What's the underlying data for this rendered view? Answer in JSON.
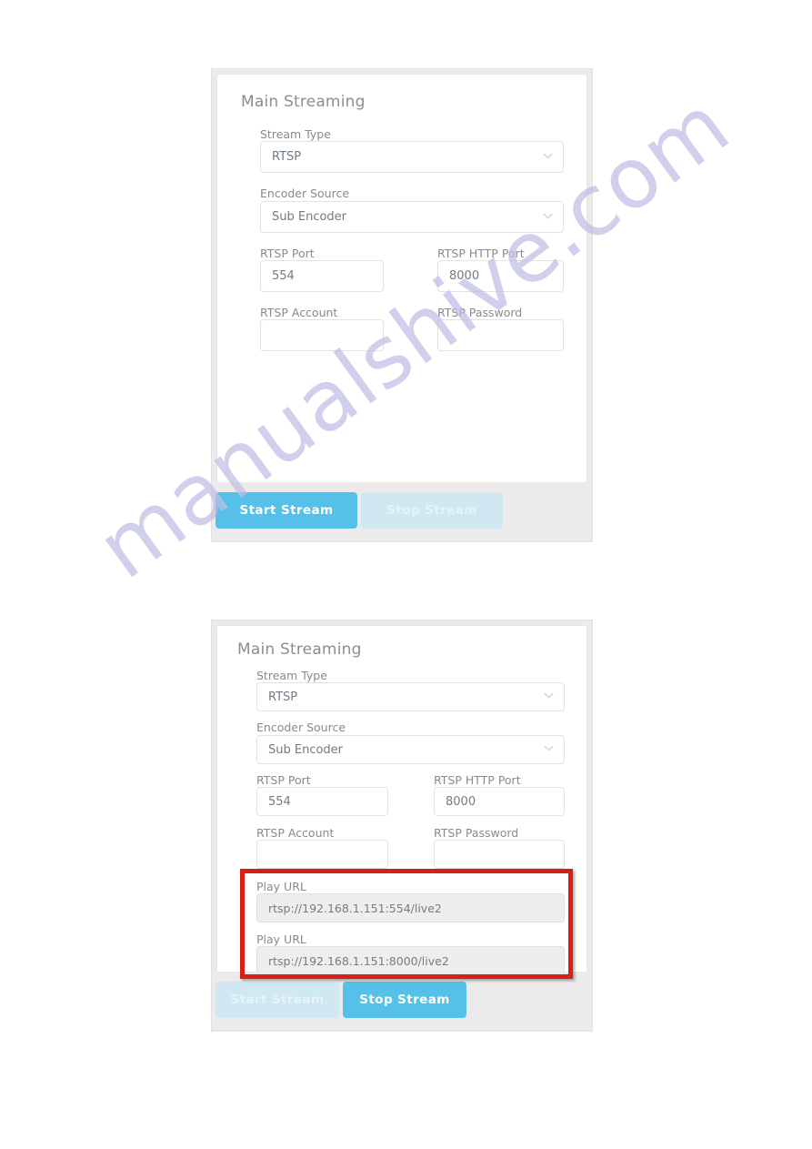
{
  "watermark": {
    "text": "manualshive.com",
    "color": "#bfbde6"
  },
  "theme": {
    "accent": "#55c1e8",
    "accent_disabled": "#cfe8f1",
    "highlight": "#d81f16",
    "panel_bg": "#eceaea",
    "card_bg": "#ffffff",
    "readonly_bg": "#eeeeee"
  },
  "panels": [
    {
      "title": "Main Streaming",
      "fields": {
        "stream_type": {
          "label": "Stream Type",
          "value": "RTSP",
          "icon": "chevron-down-icon"
        },
        "encoder_source": {
          "label": "Encoder Source",
          "value": "Sub Encoder",
          "icon": "chevron-down-icon"
        },
        "rtsp_port": {
          "label": "RTSP Port",
          "value": "554"
        },
        "rtsp_http_port": {
          "label": "RTSP HTTP Port",
          "value": "8000"
        },
        "rtsp_account": {
          "label": "RTSP Account",
          "value": ""
        },
        "rtsp_password": {
          "label": "RTSP Password",
          "value": ""
        }
      },
      "buttons": {
        "start": {
          "label": "Start Stream",
          "state": "active"
        },
        "stop": {
          "label": "Stop Stream",
          "state": "disabled"
        }
      }
    },
    {
      "title": "Main Streaming",
      "fields": {
        "stream_type": {
          "label": "Stream Type",
          "value": "RTSP",
          "icon": "chevron-down-icon"
        },
        "encoder_source": {
          "label": "Encoder Source",
          "value": "Sub Encoder",
          "icon": "chevron-down-icon"
        },
        "rtsp_port": {
          "label": "RTSP Port",
          "value": "554"
        },
        "rtsp_http_port": {
          "label": "RTSP HTTP Port",
          "value": "8000"
        },
        "rtsp_account": {
          "label": "RTSP Account",
          "value": ""
        },
        "rtsp_password": {
          "label": "RTSP Password",
          "value": ""
        },
        "play_url_1": {
          "label": "Play URL",
          "value": "rtsp://192.168.1.151:554/live2"
        },
        "play_url_2": {
          "label": "Play URL",
          "value": "rtsp://192.168.1.151:8000/live2"
        }
      },
      "buttons": {
        "start": {
          "label": "Start Stream",
          "state": "disabled"
        },
        "stop": {
          "label": "Stop Stream",
          "state": "active"
        }
      }
    }
  ]
}
